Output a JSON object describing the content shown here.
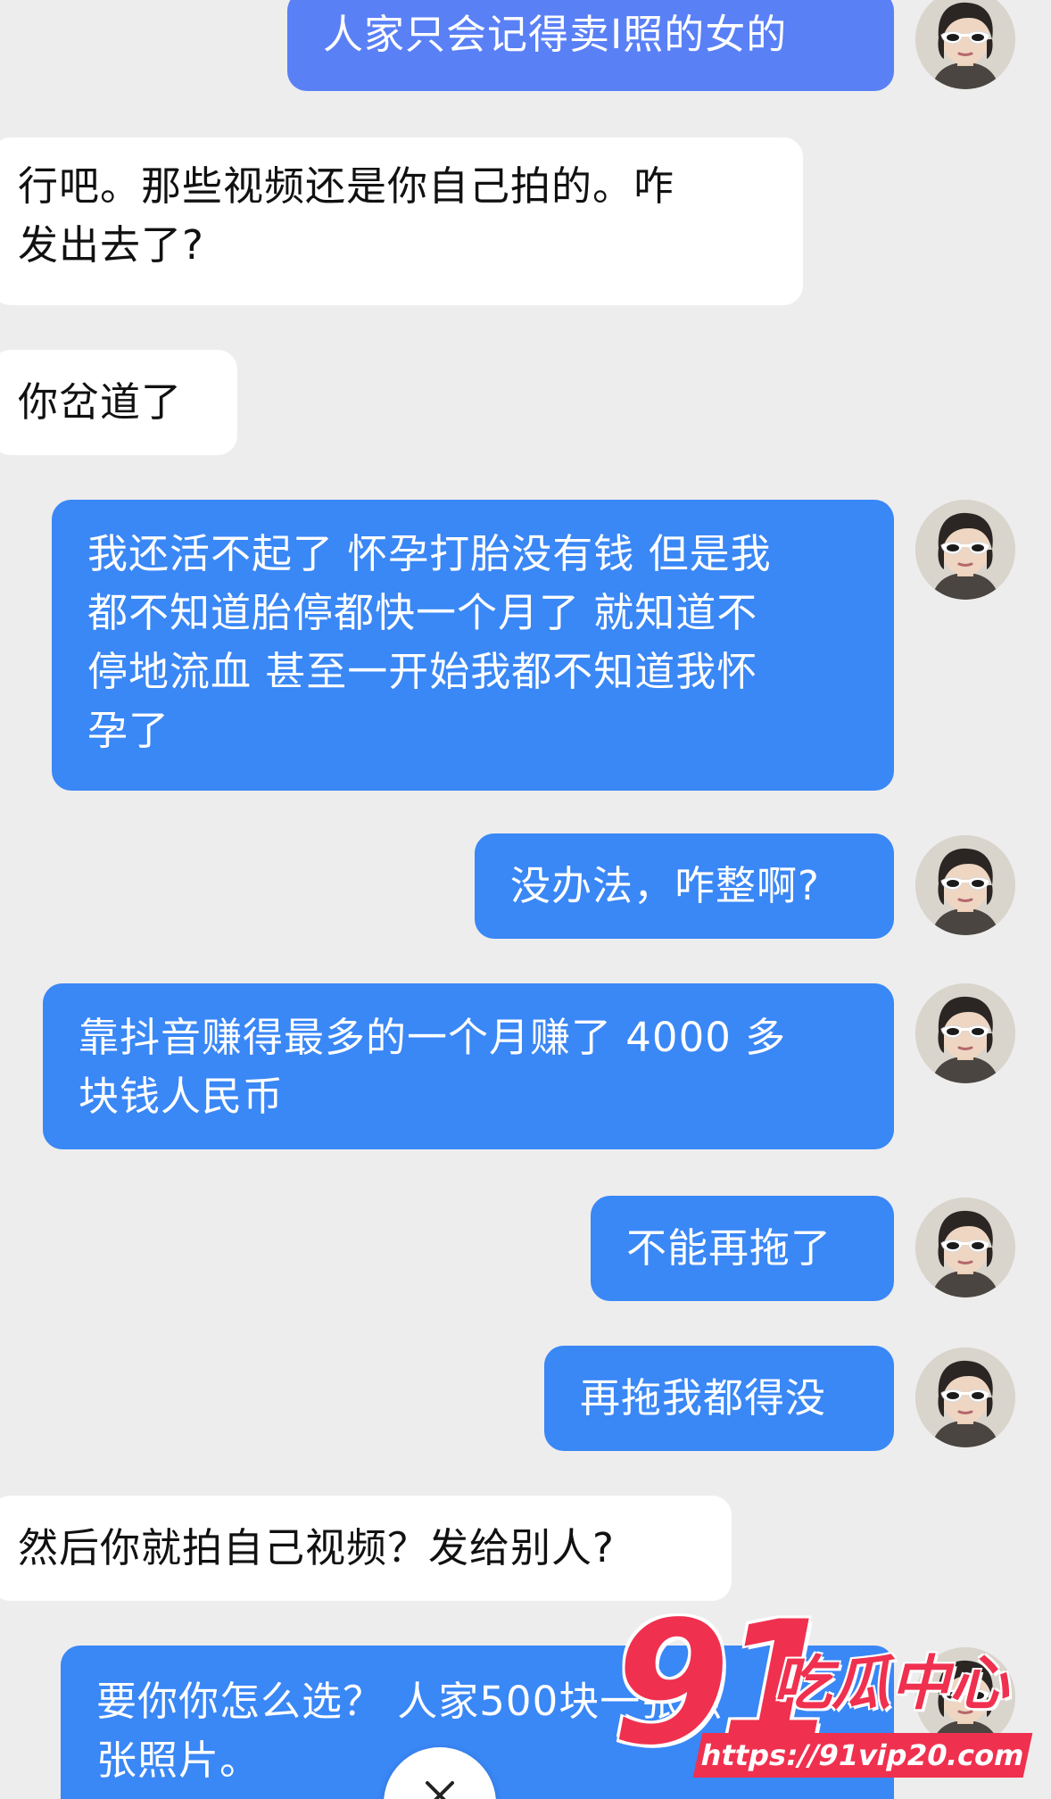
{
  "colors": {
    "background": "#ededed",
    "incoming_bubble": "#ffffff",
    "outgoing_bubble_light": "#5a80f6",
    "outgoing_bubble": "#3a87f6",
    "watermark": "#f0304f"
  },
  "messages": [
    {
      "side": "out",
      "text": "人家只会记得卖I照的女的"
    },
    {
      "side": "in",
      "text": "行吧。那些视频还是你自己拍的。咋\n发出去了?"
    },
    {
      "side": "in",
      "text": "你岔道了"
    },
    {
      "side": "out",
      "text": "我还活不起了 怀孕打胎没有钱 但是我\n都不知道胎停都快一个月了 就知道不\n停地流血 甚至一开始我都不知道我怀\n孕了"
    },
    {
      "side": "out",
      "text": "没办法，咋整啊?"
    },
    {
      "side": "out",
      "text": "靠抖音赚得最多的一个月赚了 4000 多\n块钱人民币"
    },
    {
      "side": "out",
      "text": "不能再拖了"
    },
    {
      "side": "out",
      "text": "再拖我都得没"
    },
    {
      "side": "in",
      "text": "然后你就拍自己视频？发给别人?"
    },
    {
      "side": "out",
      "text": "要你你怎么选？ 人家500块一张照\n张照片。"
    }
  ],
  "watermark": {
    "number": "91",
    "brand": "吃瓜中心",
    "url": "https://91vip20.com"
  },
  "icons": {
    "avatar": "user-avatar-sunglasses",
    "fab": "close-icon"
  }
}
